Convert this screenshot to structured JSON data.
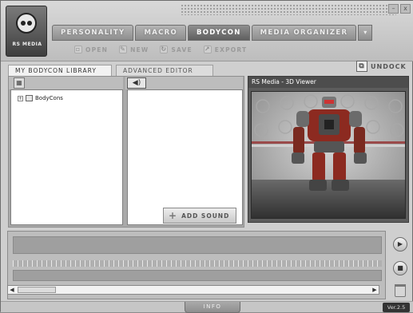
{
  "logo": {
    "text": "RS MEDIA"
  },
  "window": {
    "minimize": "–",
    "close": "x"
  },
  "main_tabs": [
    {
      "label": "PERSONALITY"
    },
    {
      "label": "MACRO"
    },
    {
      "label": "BODYCON"
    },
    {
      "label": "MEDIA ORGANIZER"
    }
  ],
  "tab_extra": "▾",
  "tools": [
    {
      "label": "OPEN",
      "icon": "open-icon"
    },
    {
      "label": "NEW",
      "icon": "new-icon"
    },
    {
      "label": "SAVE",
      "icon": "save-icon"
    },
    {
      "label": "EXPORT",
      "icon": "export-icon"
    }
  ],
  "subtabs": [
    {
      "label": "MY BODYCON LIBRARY"
    },
    {
      "label": "ADVANCED EDITOR"
    }
  ],
  "undock": {
    "label": "UNDOCK"
  },
  "library": {
    "tree_item": "BodyCons"
  },
  "editor": {
    "add_sound": "ADD SOUND"
  },
  "viewer": {
    "title": "RS Media - 3D Viewer"
  },
  "footer": {
    "info": "INFO",
    "version": "Ver.2.5"
  },
  "colors": {
    "chrome": "#cfcfcf",
    "tab": "#8d8d8d",
    "viewer_bg": "#5c5c5c"
  }
}
